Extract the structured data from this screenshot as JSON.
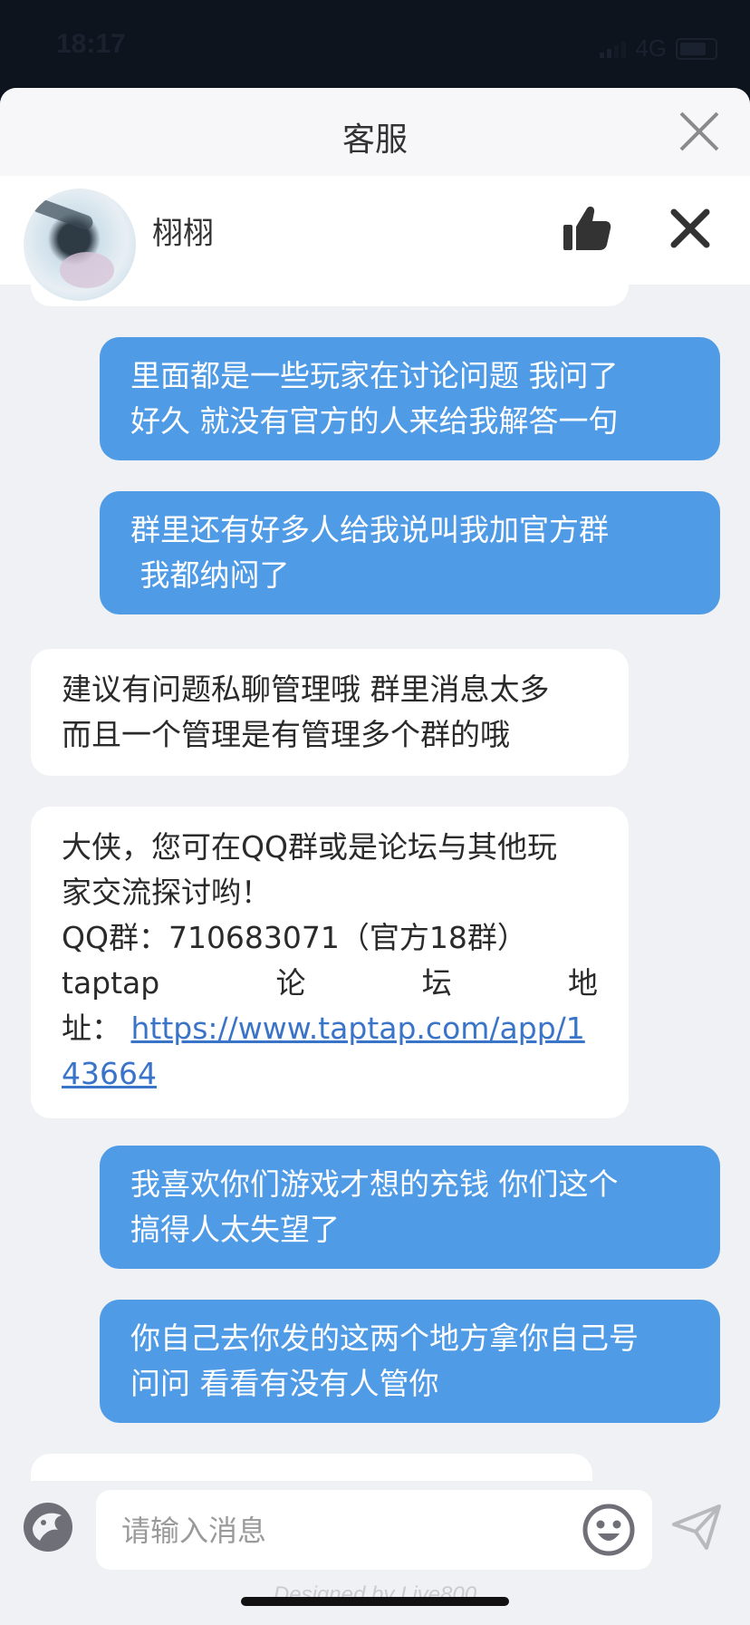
{
  "status": {
    "time": "18:17",
    "network": "4G"
  },
  "sheet": {
    "title": "客服"
  },
  "agent": {
    "name": "栩栩"
  },
  "messages": [
    {
      "from": "user",
      "lines": [
        "里面都是一些玩家在讨论问题  我问了",
        "好久  就没有官方的人来给我解答一句"
      ]
    },
    {
      "from": "user",
      "lines": [
        "群里还有好多人给我说叫我加官方群",
        " 我都纳闷了"
      ]
    },
    {
      "from": "agent",
      "lines": [
        "建议有问题私聊管理哦 群里消息太多",
        "而且一个管理是有管理多个群的哦"
      ]
    },
    {
      "from": "agent",
      "line1": "大侠，您可在QQ群或是论坛与其他玩",
      "line2": "家交流探讨哟！",
      "line3": "QQ群：710683071（官方18群）",
      "line4_words": [
        "taptap",
        "论",
        "坛",
        "地"
      ],
      "line5_prefix": "址：",
      "link": "https://www.taptap.com/app/143664"
    },
    {
      "from": "user",
      "lines": [
        "我喜欢你们游戏才想的充钱 你们这个",
        "搞得人太失望了"
      ]
    },
    {
      "from": "user",
      "lines": [
        "你自己去你发的这两个地方拿你自己号",
        "问问  看看有没有人管你"
      ]
    }
  ],
  "composer": {
    "placeholder": "请输入消息",
    "watermark": "Designed by Live800"
  },
  "colors": {
    "user_bubble": "#4f9be6",
    "agent_bubble": "#ffffff",
    "link": "#3a74c9"
  }
}
